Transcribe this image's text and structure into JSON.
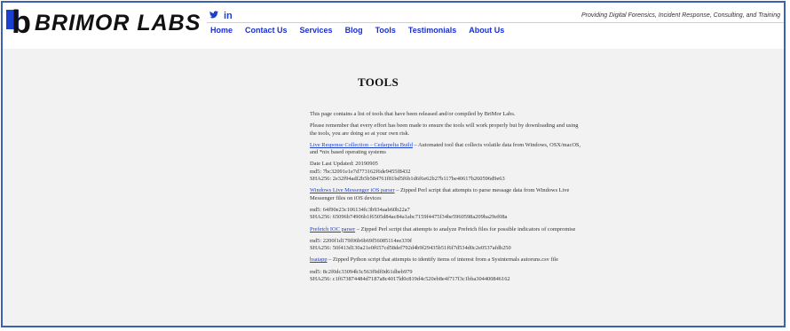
{
  "header": {
    "logo_text": "BRIMOR LABS",
    "tagline": "Providing Digital Forensics, Incident Response, Consulting, and Training",
    "social": [
      {
        "icon": "twitter-icon",
        "glyph": "𝕥"
      },
      {
        "icon": "linkedin-icon",
        "glyph": "in"
      }
    ],
    "nav": [
      "Home",
      "Contact Us",
      "Services",
      "Blog",
      "Tools",
      "Testimonials",
      "About Us"
    ]
  },
  "page": {
    "title": "TOOLS",
    "intro": "This page contains a list of tools that have been released and/or compiled by BriMor Labs.",
    "disclaimer": "Please remember that every effort has been made to ensure the tools will work properly but by downloading and using the tools, you are doing so at your own risk.",
    "tools": [
      {
        "link": "Live Response Collection – Cedarpelta Build",
        "desc": " – Automated tool that collects volatile data from Windows, OSX/macOS, and *nix based operating systems",
        "meta": [
          "Date Last Updated: 20190905",
          "md5: 7bc32091e1e7d773162f6de9455f8432",
          "SHA256: 2e32f94adf2b5b584761f81bd5f6b1d6f6e62b27b117be40617b260596d9e63"
        ]
      },
      {
        "link": "Windows Live Messenger iOS parser",
        "desc": " – Zipped Perl script that attempts to parse message data from Windows Live Messenger files on iOS devices",
        "meta": [
          "md5: 64f90e23c106134fc3b934aab60b22a7",
          "SHA256: 65096b74906b1f6505d84ac84a1abc7159f4475f34be5960598a209ba29ef08a"
        ]
      },
      {
        "link": "Prefetch IOC parser",
        "desc": " – Zipped Perl script that attempts to analyze Prefetch files for possible indicators of compromise",
        "meta": [
          "md5: 2200f1d179f06b6b69f56085114ee339f",
          "SHA256: 50f413d130a21e0f657cd58def792d4b9f29435b51f6f7d534d0c2e0537afdb250"
        ]
      },
      {
        "link": "bsatapp",
        "desc": " – Zipped Python script that attempts to identify items of interest from a Sysinternals autoruns.csv file",
        "meta": [
          "md5: 8c2f0dc33094b3c563f9df0d61dbeb979",
          "SHA256: c1f673874484d7187a8c4017ld0c819d4c520eb8e4f717f3c1bba304400846162"
        ]
      }
    ]
  }
}
